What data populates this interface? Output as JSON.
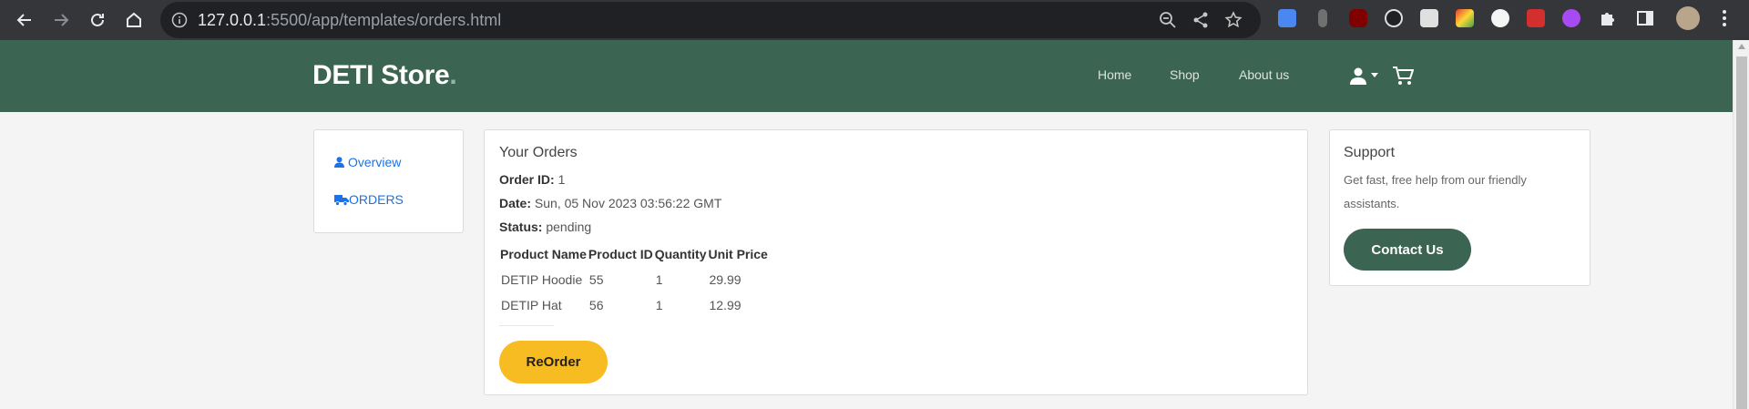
{
  "browser": {
    "url_host": "127.0.0.1",
    "url_rest": ":5500/app/templates/orders.html"
  },
  "header": {
    "brand": "DETI Store",
    "brand_dot": ".",
    "nav": [
      "Home",
      "Shop",
      "About us"
    ]
  },
  "sidebar": {
    "items": [
      {
        "label": "Overview",
        "icon": "user-icon"
      },
      {
        "label": "ORDERS",
        "icon": "truck-icon"
      }
    ]
  },
  "orders": {
    "title": "Your Orders",
    "order_id_label": "Order ID:",
    "order_id": "1",
    "date_label": "Date:",
    "date": "Sun, 05 Nov 2023 03:56:22 GMT",
    "status_label": "Status:",
    "status": "pending",
    "columns": [
      "Product Name",
      "Product ID",
      "Quantity",
      "Unit Price"
    ],
    "rows": [
      [
        "DETIP Hoodie",
        "55",
        "1",
        "29.99"
      ],
      [
        "DETIP Hat",
        "56",
        "1",
        "12.99"
      ]
    ],
    "reorder_label": "ReOrder"
  },
  "support": {
    "title": "Support",
    "text": "Get fast, free help from our friendly assistants.",
    "button_label": "Contact Us"
  },
  "colors": {
    "header_bg": "#3c6452",
    "reorder_bg": "#f7bc21",
    "link": "#1a73e8"
  }
}
